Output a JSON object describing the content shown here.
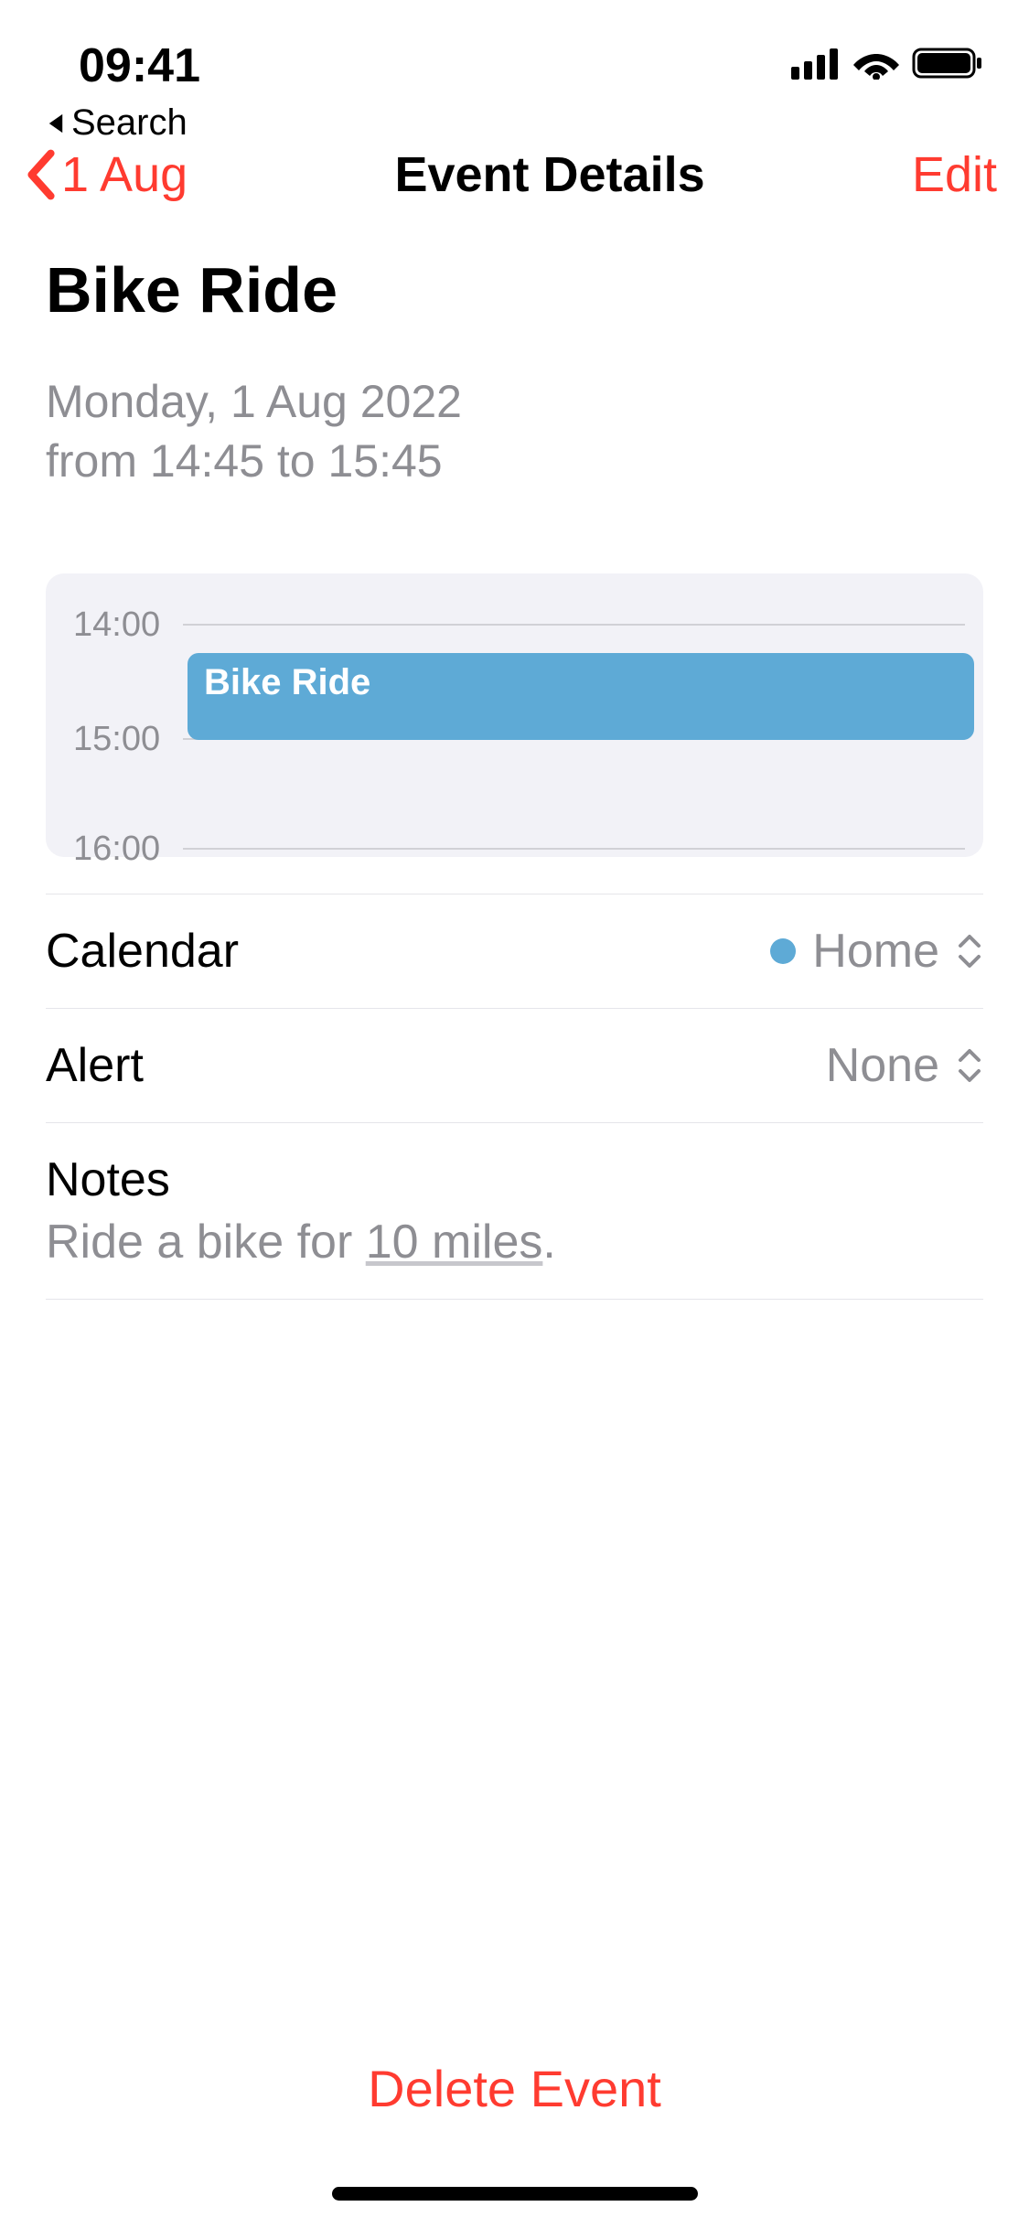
{
  "statusbar": {
    "time": "09:41",
    "back_app_label": "Search"
  },
  "nav": {
    "back_label": "1 Aug",
    "title": "Event Details",
    "edit_label": "Edit"
  },
  "event": {
    "title": "Bike Ride",
    "date_line": "Monday, 1 Aug 2022",
    "time_line": "from 14:45 to 15:45"
  },
  "timeline": {
    "hours": [
      "14:00",
      "15:00",
      "16:00"
    ],
    "block_label": "Bike Ride"
  },
  "rows": {
    "calendar_label": "Calendar",
    "calendar_value": "Home",
    "calendar_color": "#5eaad6",
    "alert_label": "Alert",
    "alert_value": "None",
    "notes_label": "Notes",
    "notes_text_before": "Ride a bike for ",
    "notes_text_underlined": "10 miles",
    "notes_text_after": "."
  },
  "delete_label": "Delete Event"
}
